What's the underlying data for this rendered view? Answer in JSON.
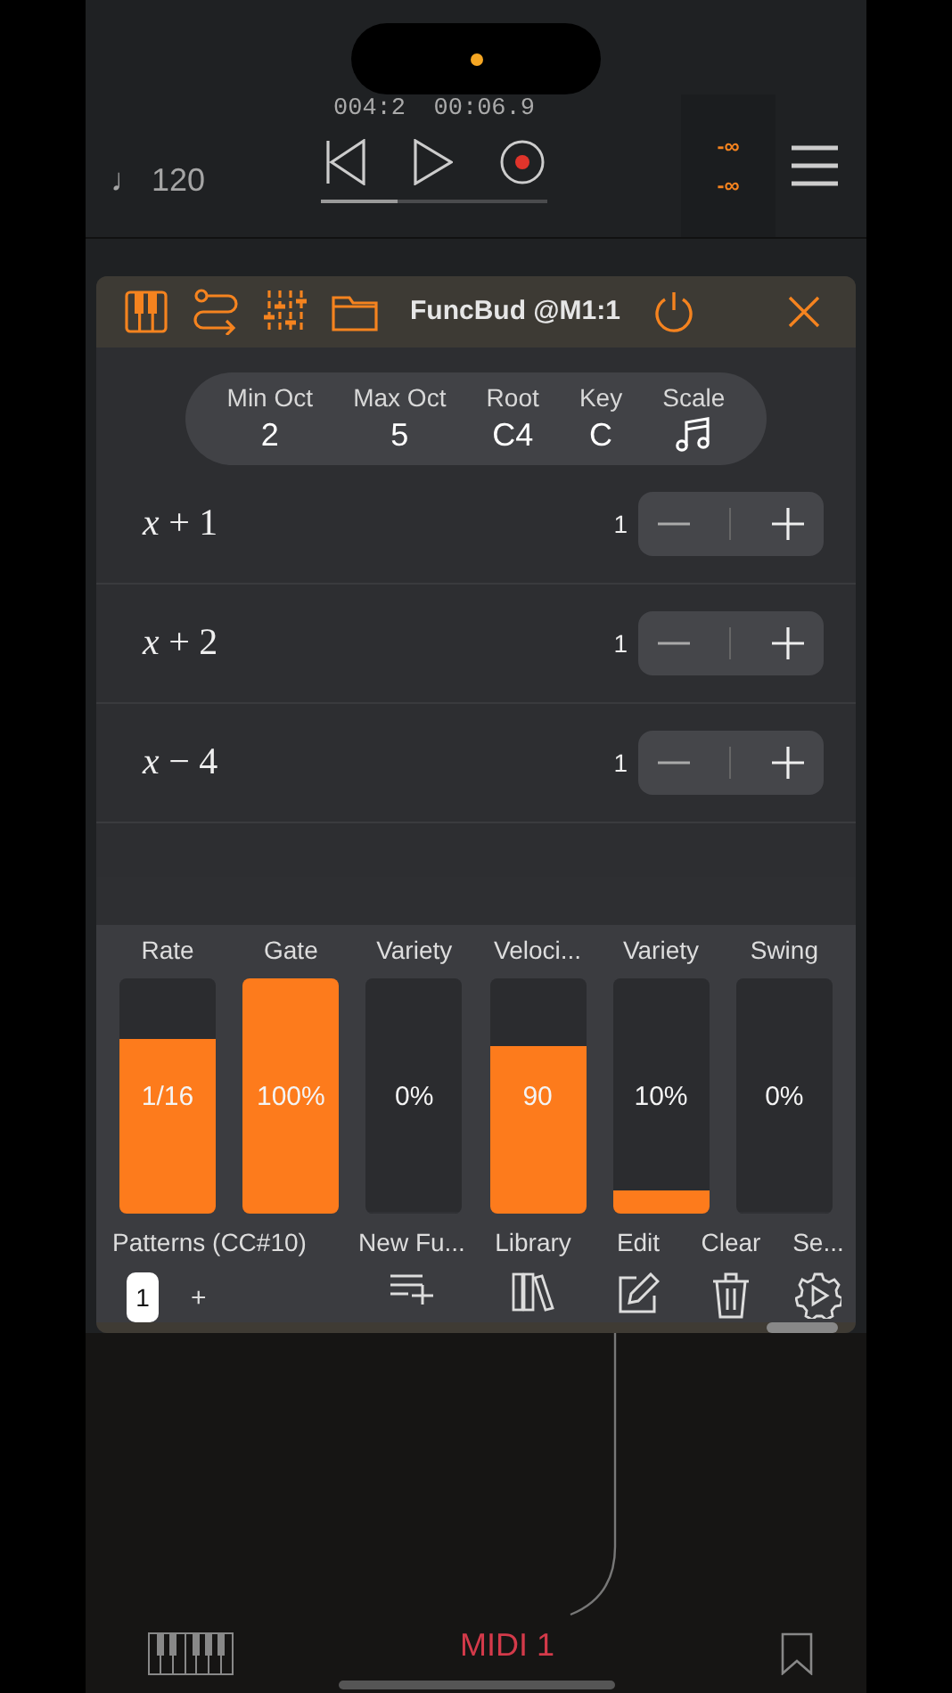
{
  "transport": {
    "tempo": "♩ 120",
    "position": "004:2",
    "time": "00:06.9",
    "level": 0.34
  },
  "meter": [
    "-∞",
    "-∞"
  ],
  "plugin": {
    "title": "FuncBud @M1:1",
    "on": true
  },
  "settings": [
    {
      "label": "Min Oct",
      "value": "2",
      "kind": "text"
    },
    {
      "label": "Max Oct",
      "value": "5",
      "kind": "text"
    },
    {
      "label": "Root",
      "value": "C4",
      "kind": "text"
    },
    {
      "label": "Key",
      "value": "C",
      "kind": "text"
    },
    {
      "label": "Scale",
      "kind": "icon"
    }
  ],
  "functions": [
    {
      "expr": "*x* + 1",
      "count": "1"
    },
    {
      "expr": "*x* + 2",
      "count": "1"
    },
    {
      "expr": "*x* − 4",
      "count": "1"
    }
  ],
  "sliders": [
    {
      "label": "Rate",
      "value": "1/16",
      "level": 0.74
    },
    {
      "label": "Gate",
      "value": "100%",
      "level": 1
    },
    {
      "label": "Variety",
      "value": "0%",
      "level": 0
    },
    {
      "label": "Veloci...",
      "value": "90",
      "level": 0.71
    },
    {
      "label": "Variety",
      "value": "10%",
      "level": 0.1
    },
    {
      "label": "Swing",
      "value": "0%",
      "level": 0
    }
  ],
  "patterns": {
    "label": "Patterns (CC#10)",
    "items": [
      {
        "label": "1",
        "selected": true
      }
    ],
    "add": "+"
  },
  "actions": [
    {
      "label": "New Fu...",
      "kind": "new"
    },
    {
      "label": "Library",
      "kind": "library"
    },
    {
      "label": "Edit",
      "kind": "edit"
    },
    {
      "label": "Clear",
      "kind": "clear"
    },
    {
      "label": "Se...",
      "kind": "settings"
    }
  ],
  "footer": {
    "track": "MIDI 1"
  }
}
